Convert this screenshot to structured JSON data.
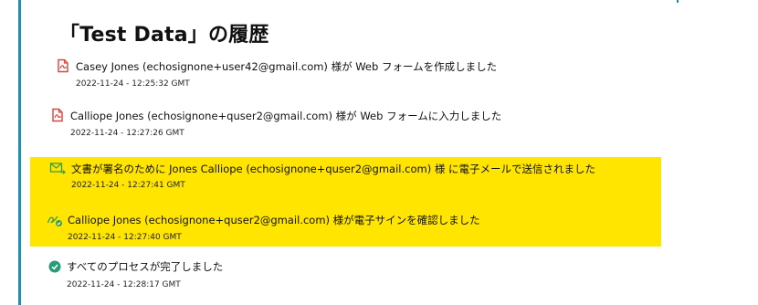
{
  "page": {
    "title_open": "「Test Data」",
    "title_rest": "の履歴"
  },
  "history": [
    {
      "icon": "document-pdf-icon",
      "text": "Casey Jones (echosignone+user42@gmail.com) 様が Web フォームを作成しました",
      "timestamp": "2022-11-24 - 12:25:32 GMT",
      "highlighted": false
    },
    {
      "icon": "document-pdf-icon",
      "text": "Calliope Jones (echosignone+quser2@gmail.com) 様が Web フォームに入力しました",
      "timestamp": "2022-11-24 - 12:27:26 GMT",
      "highlighted": false
    },
    {
      "icon": "email-send-icon",
      "text": "文書が署名のために Jones Calliope (echosignone+quser2@gmail.com) 様 に電子メールで送信されました",
      "timestamp": "2022-11-24 - 12:27:41 GMT",
      "highlighted": true
    },
    {
      "icon": "signature-check-icon",
      "text": "Calliope Jones (echosignone+quser2@gmail.com) 様が電子サインを確認しました",
      "timestamp": "2022-11-24 - 12:27:40 GMT",
      "highlighted": true
    },
    {
      "icon": "check-circle-icon",
      "text": "すべてのプロセスが完了しました",
      "timestamp": "2022-11-24 - 12:28:17 GMT",
      "highlighted": false
    }
  ],
  "colors": {
    "accent_rule": "#1b8fb8",
    "highlight": "#ffe500",
    "pdf_icon": "#d9453a",
    "email_icon": "#3a9d4a",
    "signature_icon": "#3a9d4a",
    "complete_icon": "#2a9b77"
  }
}
